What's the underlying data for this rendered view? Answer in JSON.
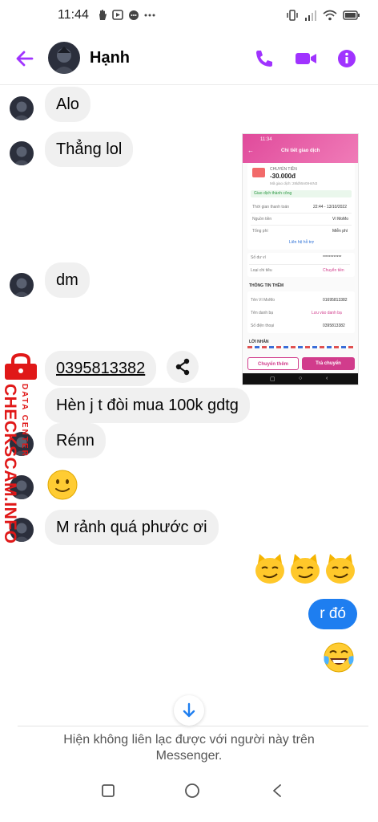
{
  "status_bar": {
    "time": "11:44",
    "left_icons": [
      "hand-icon",
      "messenger-icon",
      "chat-icon",
      "more-dots-icon"
    ],
    "right_icons": [
      "vibrate-icon",
      "signal-icon",
      "wifi-icon",
      "battery-icon"
    ]
  },
  "header": {
    "contact_name": "Hạnh",
    "accent_color": "#a033ff",
    "icons": [
      "back-arrow-icon",
      "phone-icon",
      "video-camera-icon",
      "info-icon"
    ]
  },
  "messages": [
    {
      "text": "Alo"
    },
    {
      "text": "Thẳng lol"
    },
    {
      "text": "dm"
    },
    {
      "text": "0395813382"
    },
    {
      "text": "Hèn j t đòi mua 100k gdtg"
    },
    {
      "text": "Rénn"
    },
    {
      "text": "M rảnh quá phước ơi"
    }
  ],
  "my_message": {
    "text": "r đó",
    "color": "#1e7ef0"
  },
  "screenshot": {
    "time": "11:34",
    "title": "Chi tiết giao dịch",
    "type_label": "CHUYỂN TIỀN",
    "amount": "-30.000đ",
    "code": "Mã giao dịch: 28ldh5n0tH4N3",
    "status": "Giao dịch thành công",
    "rows": [
      {
        "label": "Thời gian thanh toán",
        "value": "22:44 - 13/10/2022"
      },
      {
        "label": "Nguồn tiền",
        "value": "Ví MoMo"
      },
      {
        "label": "Tổng phí",
        "value": "Miễn phí"
      }
    ],
    "support": "Liên hệ hỗ trợ",
    "balance_label": "Số dư ví",
    "balance_value": "************",
    "category_label": "Loại chi tiêu",
    "category_value": "Chuyển tiền",
    "more_info": "THÔNG TIN THÊM",
    "info_rows": [
      {
        "label": "Tên Ví MoMo",
        "value": "01695813382"
      },
      {
        "label": "Tên danh bạ",
        "value": "Lưu vào danh bạ"
      },
      {
        "label": "Số điện thoại",
        "value": "0395813382"
      }
    ],
    "message_label": "LỜI NHẮN",
    "btn_more": "Chuyển thêm",
    "btn_return": "Trả chuyển"
  },
  "watermark": {
    "brand": "CHECKSCAM.INFO",
    "sub": "DATA CENTER",
    "color": "#e01818"
  },
  "footer": {
    "notice": "Hiện không liên lạc được với người này trên Messenger."
  }
}
